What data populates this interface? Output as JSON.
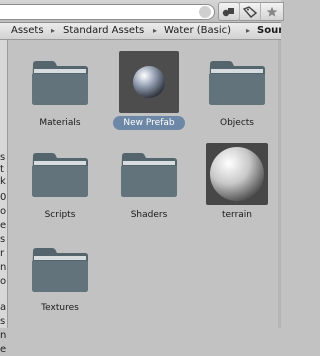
{
  "toolbar": {
    "search": {
      "value": "",
      "placeholder": ""
    },
    "buttons": [
      {
        "icon": "filter-by-type-icon"
      },
      {
        "icon": "filter-by-label-icon"
      },
      {
        "icon": "favorite-star-icon"
      }
    ]
  },
  "breadcrumb": {
    "items": [
      "Assets",
      "Standard Assets",
      "Water (Basic)",
      "Sour"
    ],
    "separator": "▸"
  },
  "left_panel": {
    "visible_chars": [
      "s",
      "t",
      "k",
      "0",
      "o",
      "e",
      "s",
      "r",
      "n",
      "o",
      "a",
      "s",
      "n",
      "e"
    ]
  },
  "assets": [
    {
      "label": "Materials",
      "type": "folder"
    },
    {
      "label": "New Prefab",
      "type": "prefab",
      "selected": true
    },
    {
      "label": "Objects",
      "type": "folder"
    },
    {
      "label": "Scripts",
      "type": "folder"
    },
    {
      "label": "Shaders",
      "type": "folder"
    },
    {
      "label": "terrain",
      "type": "material"
    },
    {
      "label": "Textures",
      "type": "folder"
    }
  ],
  "colors": {
    "background": "#c2c2c2",
    "folder": "#5d6e76",
    "selection": "#6d87a6"
  }
}
